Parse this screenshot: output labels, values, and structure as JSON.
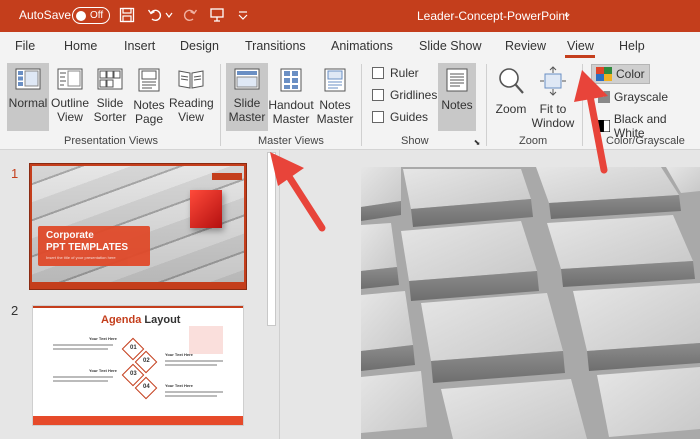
{
  "titlebar": {
    "autosave_label": "AutoSave",
    "autosave_state": "Off",
    "doc_title": "Leader-Concept-PowerPoint",
    "title_caret": "⌄"
  },
  "tabs": [
    {
      "label": "File"
    },
    {
      "label": "Home"
    },
    {
      "label": "Insert"
    },
    {
      "label": "Design"
    },
    {
      "label": "Transitions"
    },
    {
      "label": "Animations"
    },
    {
      "label": "Slide Show"
    },
    {
      "label": "Review"
    },
    {
      "label": "View",
      "active": true
    },
    {
      "label": "Help"
    }
  ],
  "ribbon": {
    "presentation_views": {
      "group_label": "Presentation Views",
      "buttons": [
        {
          "line1": "Normal",
          "line2": "",
          "selected": true
        },
        {
          "line1": "Outline",
          "line2": "View"
        },
        {
          "line1": "Slide",
          "line2": "Sorter"
        },
        {
          "line1": "Notes",
          "line2": "Page"
        },
        {
          "line1": "Reading",
          "line2": "View"
        }
      ]
    },
    "master_views": {
      "group_label": "Master Views",
      "buttons": [
        {
          "line1": "Slide",
          "line2": "Master",
          "selected": true
        },
        {
          "line1": "Handout",
          "line2": "Master"
        },
        {
          "line1": "Notes",
          "line2": "Master"
        }
      ]
    },
    "show": {
      "group_label": "Show",
      "checkboxes": [
        {
          "label": "Ruler",
          "checked": false
        },
        {
          "label": "Gridlines",
          "checked": false
        },
        {
          "label": "Guides",
          "checked": false
        }
      ],
      "notes_button": "Notes"
    },
    "zoom": {
      "group_label": "Zoom",
      "zoom_button": "Zoom",
      "fit_line1": "Fit to",
      "fit_line2": "Window"
    },
    "color": {
      "group_label": "Color/Grayscale",
      "options": [
        {
          "label": "Color",
          "selected": true
        },
        {
          "label": "Grayscale"
        },
        {
          "label": "Black and White"
        }
      ]
    }
  },
  "slides": [
    {
      "number": "1",
      "title_line1": "Corporate",
      "title_line2": "PPT TEMPLATES",
      "subtitle": "Insert the title of your presentation here"
    },
    {
      "number": "2",
      "title_accent": "Agenda",
      "title_rest": " Layout",
      "items": [
        "01",
        "02",
        "03",
        "04"
      ],
      "item_title": "Your Text Here"
    }
  ],
  "colors": {
    "accent": "#c43e1c",
    "arrow": "#e8443a",
    "ribbon_bg": "#f3f3f3",
    "panel_bg": "#e6e6e6"
  }
}
